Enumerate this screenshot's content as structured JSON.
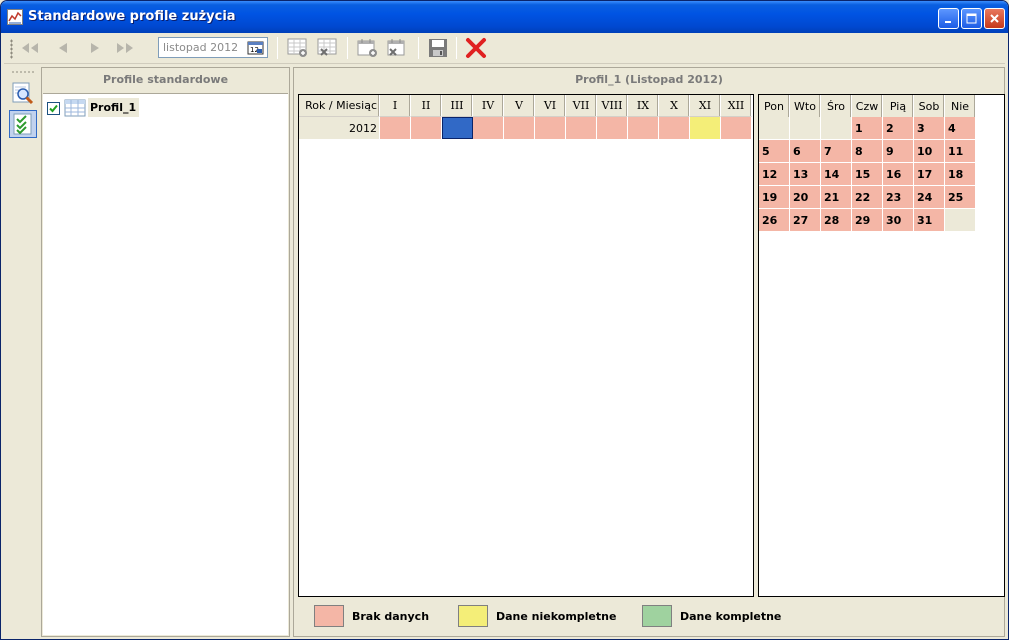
{
  "window": {
    "title": "Standardowe profile zużycia"
  },
  "toolbar": {
    "month_value": "listopad 2012",
    "buttons": [
      "first",
      "prev",
      "next",
      "last",
      "add-profile",
      "delete-profile",
      "add-day",
      "delete-day",
      "save",
      "close"
    ]
  },
  "left": {
    "header": "Profile standardowe",
    "items": [
      {
        "label": "Profil_1",
        "checked": true
      }
    ]
  },
  "right": {
    "header": "Profil_1 (Listopad 2012)",
    "months_header": {
      "row_label": "Rok / Miesiąc",
      "months": [
        "I",
        "II",
        "III",
        "IV",
        "V",
        "VI",
        "VII",
        "VIII",
        "IX",
        "X",
        "XI",
        "XII"
      ]
    },
    "months_rows": [
      {
        "year": "2012",
        "states": [
          "nodata",
          "nodata",
          "selected",
          "nodata",
          "nodata",
          "nodata",
          "nodata",
          "nodata",
          "nodata",
          "nodata",
          "partial",
          "nodata"
        ]
      }
    ],
    "days_header": [
      "Pon",
      "Wto",
      "Śro",
      "Czw",
      "Pią",
      "Sob",
      "Nie"
    ],
    "days_weeks": [
      [
        "",
        "",
        "",
        "1",
        "2",
        "3",
        "4"
      ],
      [
        "5",
        "6",
        "7",
        "8",
        "9",
        "10",
        "11"
      ],
      [
        "12",
        "13",
        "14",
        "15",
        "16",
        "17",
        "18"
      ],
      [
        "19",
        "20",
        "21",
        "22",
        "23",
        "24",
        "25"
      ],
      [
        "26",
        "27",
        "28",
        "29",
        "30",
        "31",
        ""
      ]
    ]
  },
  "legend": [
    {
      "label": "Brak danych",
      "color": "#f4b6a6"
    },
    {
      "label": "Dane niekompletne",
      "color": "#f4ee78"
    },
    {
      "label": "Dane kompletne",
      "color": "#9fd29f"
    }
  ],
  "colors": {
    "nodata": "#f4b6a6",
    "partial": "#f4ee78",
    "full": "#9fd29f",
    "selected": "#3169c6"
  }
}
